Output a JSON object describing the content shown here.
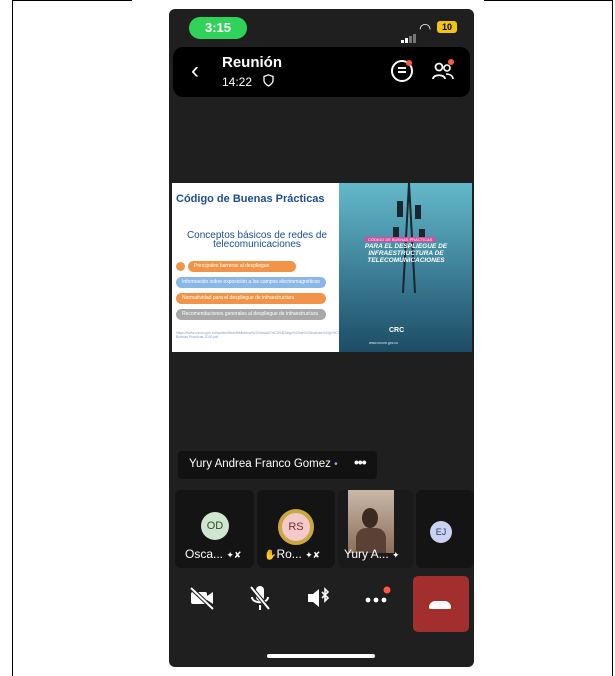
{
  "status": {
    "time": "3:15",
    "battery": "10"
  },
  "header": {
    "title": "Reunión",
    "elapsed": "14:22"
  },
  "slide": {
    "title": "Código de Buenas Prácticas",
    "subtitle": "Conceptos básicos de redes de telecomunicaciones",
    "bullets": [
      "Principales barreras al despliegue",
      "Información sobre exposición a los campos electromagnéticos",
      "Normatividad para el despliegue de infraestructura",
      "Recomendaciones generales al despliegue de infraestructura"
    ],
    "links": "https://www.crcom.gov.co/system/files/Biblioteca%20Virtual/C%C3%B3digo%20de%20buenas%20pr%C3%A1cticas/Codigo-Buenas-Practicas-2020.pdf",
    "right_head": "CÓDIGO DE BUENAS PRÁCTICAS",
    "right_title": "PARA EL DESPLIEGUE DE INFRAESTRUCTURA DE TELECOMUNICACIONES",
    "logo": "CRC",
    "footer": "www.crcom.gov.co"
  },
  "speaker": {
    "name": "Yury Andrea Franco Gomez",
    "more": "•••"
  },
  "participants": [
    {
      "initials": "OD",
      "name": "Osca...",
      "avatar_color": "#cfe6cf"
    },
    {
      "initials": "RS",
      "name": "Ro...",
      "avatar_color": "#f3c9c9"
    },
    {
      "initials": "",
      "name": "Yury A..."
    },
    {
      "initials": "EJ",
      "name": "",
      "avatar_color": "#c9d2f0"
    }
  ],
  "colors": {
    "accent_green": "#2fd35a",
    "end_call": "#a32e2e",
    "notify": "#ff5a3c"
  }
}
